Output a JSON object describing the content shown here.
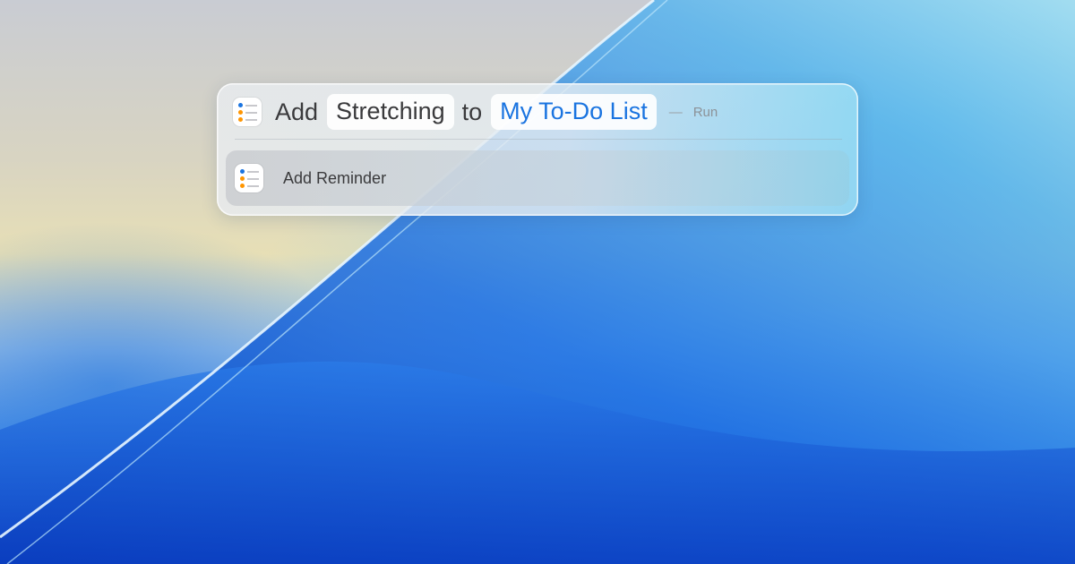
{
  "palette": {
    "app_icon": "reminders-icon",
    "verb": "Add",
    "item_token": "Stretching",
    "preposition": "to",
    "list_token": "My To-Do List",
    "dash": "—",
    "run_label": "Run",
    "accent_color": "#1a74e0"
  },
  "results": [
    {
      "icon": "reminders-icon",
      "label": "Add Reminder"
    }
  ]
}
